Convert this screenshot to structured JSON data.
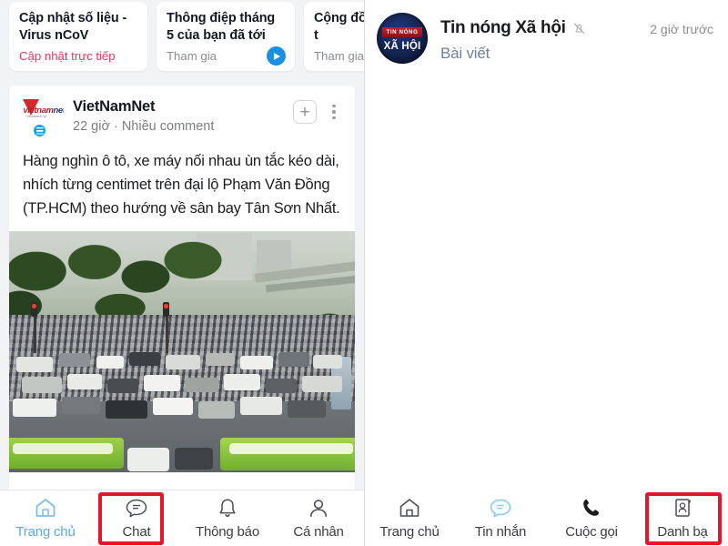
{
  "left_panel": {
    "promo_cards": [
      {
        "title": "Cập nhật số liệu - Virus nCoV",
        "action": "Cập nhật trực tiếp",
        "style": "live",
        "has_play": false
      },
      {
        "title": "Thông điệp tháng 5 của bạn đã tới",
        "action": "Tham gia",
        "style": "normal",
        "has_play": true
      },
      {
        "title": "Cộng đồn quà, đối t",
        "action": "Tham gia",
        "style": "normal",
        "has_play": false
      }
    ],
    "post": {
      "author": "VietNamNet",
      "logo_text_1": "ietnam",
      "logo_text_2": "net",
      "logo_tagline": "vietnamnet.vn",
      "meta": "22 giờ  ·  Nhiều comment",
      "body": "Hàng nghìn ô tô, xe máy nối nhau ùn tắc kéo dài, nhích từng centimet trên đại lộ Phạm Văn Đồng (TP.HCM) theo hướng về sân bay Tân Sơn Nhất.",
      "follow_button": "+",
      "image_alt": "Ảnh ùn tắc giao thông đại lộ Phạm Văn Đồng"
    },
    "bottom_nav": {
      "items": [
        {
          "label": "Trang chủ",
          "icon": "home-icon",
          "active": true,
          "highlighted": false
        },
        {
          "label": "Chat",
          "icon": "chat-bubble-icon",
          "active": false,
          "highlighted": true
        },
        {
          "label": "Thông báo",
          "icon": "bell-icon",
          "active": false,
          "highlighted": false
        },
        {
          "label": "Cá nhân",
          "icon": "person-icon",
          "active": false,
          "highlighted": false
        }
      ]
    }
  },
  "right_panel": {
    "header": {
      "avatar_ribbon": "TIN NÓNG",
      "avatar_main": "XÃ HỘI",
      "name": "Tin nóng Xã hội",
      "mute_icon": "bell-muted-icon",
      "subtitle": "Bài viết",
      "time": "2 giờ trước"
    },
    "bottom_nav": {
      "items": [
        {
          "label": "Trang chủ",
          "icon": "home-icon",
          "active": false,
          "highlighted": false
        },
        {
          "label": "Tin nhắn",
          "icon": "chat-bubble-icon",
          "active": true,
          "highlighted": false
        },
        {
          "label": "Cuộc gọi",
          "icon": "phone-icon",
          "active": false,
          "highlighted": false
        },
        {
          "label": "Danh bạ",
          "icon": "contacts-card-icon",
          "active": false,
          "highlighted": true
        }
      ]
    }
  },
  "colors": {
    "highlight_red": "#e8142a",
    "accent_blue": "#1a8fe3",
    "live_pink": "#e8375a",
    "nav_active_blue": "#5aa9e0",
    "subtitle_blue": "#6d8299"
  }
}
